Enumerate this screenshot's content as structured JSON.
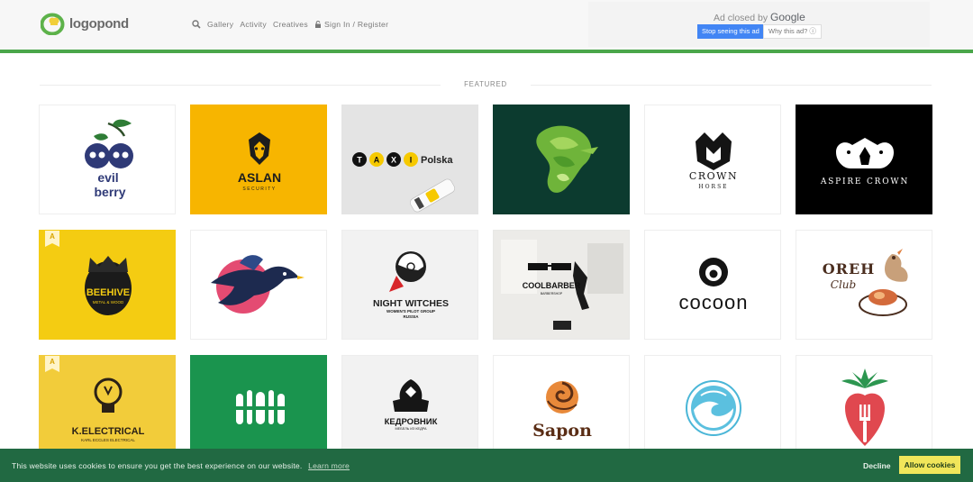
{
  "header": {
    "logo_text": "logopond",
    "nav": {
      "gallery": "Gallery",
      "activity": "Activity",
      "creatives": "Creatives",
      "signin": "Sign In / Register"
    }
  },
  "ad": {
    "closed_prefix": "Ad closed by",
    "closed_brand": "Google",
    "stop_label": "Stop seeing this ad",
    "why_label": "Why this ad? ⓘ"
  },
  "section": {
    "featured_label": "FEATURED"
  },
  "tiles": [
    {
      "name": "evil berry",
      "line1": "evil",
      "line2": "berry"
    },
    {
      "name": "ASLAN security",
      "line1": "ASLAN",
      "line2": "SECURITY"
    },
    {
      "name": "TAXI Polska",
      "line1": "T",
      "line2": "A",
      "line3": "X",
      "line4": "I",
      "line5": "Polska"
    },
    {
      "name": "leaf dragon",
      "line1": ""
    },
    {
      "name": "CROWN HORSE",
      "line1": "CROWN",
      "line2": "HORSE"
    },
    {
      "name": "ASPIRE CROWN",
      "line1": "ASPIRE CROWN"
    },
    {
      "name": "BEEHIVE",
      "line1": "BEEHIVE",
      "line2": "METAL & WOOD"
    },
    {
      "name": "bird",
      "line1": ""
    },
    {
      "name": "NIGHT WITCHES",
      "line1": "NIGHT WITCHES",
      "line2": "WOMEN'S PILOT GROUP",
      "line3": "RUSSIA"
    },
    {
      "name": "COOLBARBER",
      "line1": "COOLBARBER",
      "line2": "BARBERSHOP"
    },
    {
      "name": "cocoon",
      "line1": "cocoon"
    },
    {
      "name": "OREH Club",
      "line1": "OREH",
      "line2": "Club"
    },
    {
      "name": "K.ELECTRICAL",
      "line1": "K.ELECTRICAL",
      "line2": "KARL ECCLES ELECTRICAL"
    },
    {
      "name": "barcode building",
      "line1": ""
    },
    {
      "name": "КЕДРОВНИК",
      "line1": "КЕДРОВНИК",
      "line2": "МЕБЕЛЬ ИЗ КЕДРА"
    },
    {
      "name": "Sapon",
      "line1": "Sapon"
    },
    {
      "name": "wave circle",
      "line1": ""
    },
    {
      "name": "strawberry fork",
      "line1": ""
    }
  ],
  "badges": {
    "award": "A"
  },
  "cookie": {
    "text": "This website uses cookies to ensure you get the best experience on our website.",
    "learn_more": "Learn more",
    "decline": "Decline",
    "allow": "Allow cookies"
  },
  "colors": {
    "accent_green": "#4aa64a",
    "cookie_bg": "#216942",
    "allow_button": "#f1e65a",
    "ad_button": "#4285f4"
  }
}
